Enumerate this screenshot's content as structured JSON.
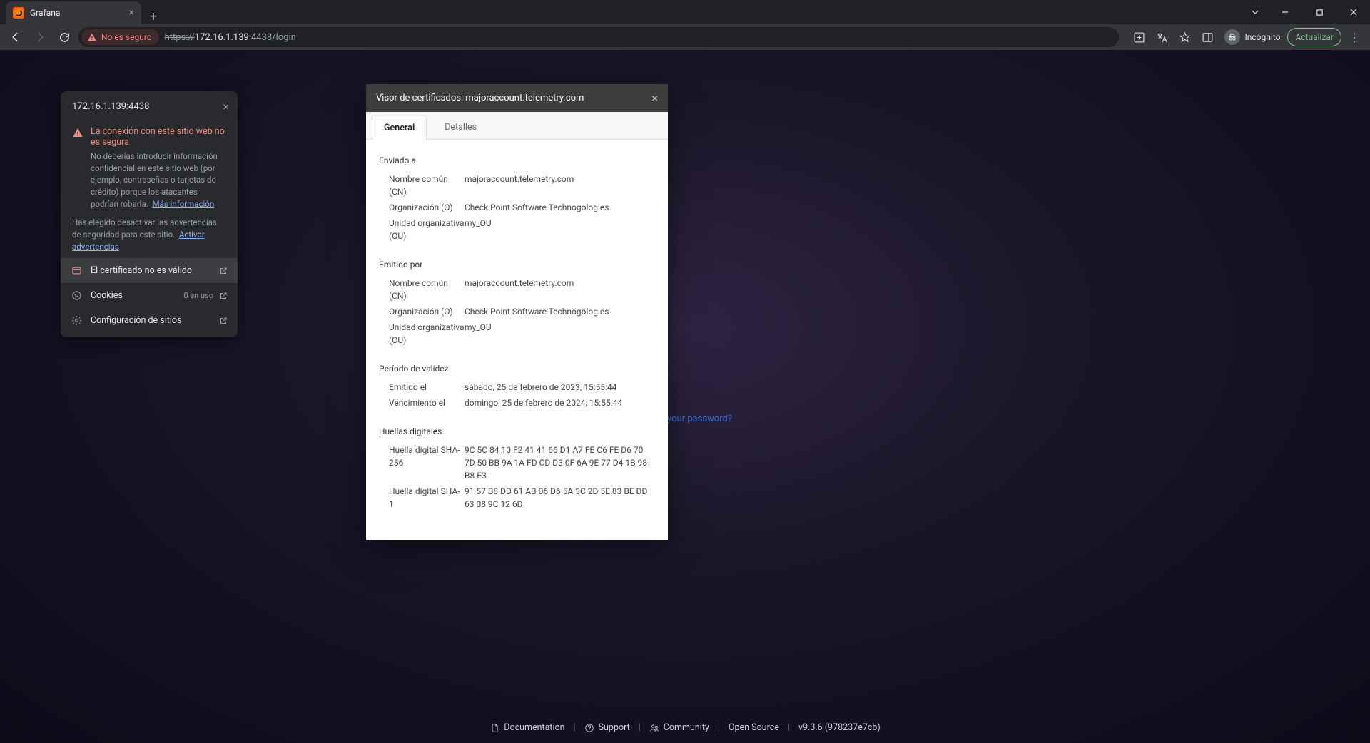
{
  "browser": {
    "tab_title": "Grafana",
    "security_chip": "No es seguro",
    "url_scheme": "https",
    "url_host": "172.16.1.139",
    "url_rest": ":4438/login",
    "incognito_label": "Incógnito",
    "update_label": "Actualizar"
  },
  "site_info": {
    "host": "172.16.1.139:4438",
    "warn_title": "La conexión con este sitio web no es segura",
    "warn_body": "No deberías introducir información confidencial en este sitio web (por ejemplo, contraseñas o tarjetas de crédito) porque los atacantes podrían robarla.",
    "warn_more": "Más información",
    "sub_body": "Has elegido desactivar las advertencias de seguridad para este sitio.",
    "sub_link": "Activar advertencias",
    "cert_invalid": "El certificado no es válido",
    "cookies_label": "Cookies",
    "cookies_count": "0 en uso",
    "site_settings": "Configuración de sitios"
  },
  "cert": {
    "title_prefix": "Visor de certificados: ",
    "title_host": "majoraccount.telemetry.com",
    "tab_general": "General",
    "tab_details": "Detalles",
    "sec_issued_to": "Enviado a",
    "sec_issued_by": "Emitido por",
    "sec_validity": "Período de validez",
    "sec_fingerprints": "Huellas digitales",
    "lbl_cn": "Nombre común (CN)",
    "lbl_o": "Organización (O)",
    "lbl_ou": "Unidad organizativa (OU)",
    "lbl_issued_on": "Emitido el",
    "lbl_expires_on": "Vencimiento el",
    "lbl_sha256": "Huella digital SHA-256",
    "lbl_sha1": "Huella digital SHA-1",
    "issued_to": {
      "cn": "majoraccount.telemetry.com",
      "o": "Check Point Software Technogologies",
      "ou": "my_OU"
    },
    "issued_by": {
      "cn": "majoraccount.telemetry.com",
      "o": "Check Point Software Technogologies",
      "ou": "my_OU"
    },
    "validity": {
      "issued": "sábado, 25 de febrero de 2023, 15:55:44",
      "expires": "domingo, 25 de febrero de 2024, 15:55:44"
    },
    "fp": {
      "sha256": "9C 5C 84 10 F2 41 41 66 D1 A7 FE C6 FE D6 70 7D 50 BB 9A 1A FD CD D3 0F 6A 9E 77 D4 1B 98 B8 E3",
      "sha1": "91 57 B8 DD 61 AB 06 D6 5A 3C 2D 5E 83 BE DD 63 08 9C 12 6D"
    }
  },
  "grafana": {
    "forgot": "Forgot your password?",
    "footer": {
      "documentation": "Documentation",
      "support": "Support",
      "community": "Community",
      "open_source": "Open Source",
      "version": "v9.3.6 (978237e7cb)"
    }
  }
}
